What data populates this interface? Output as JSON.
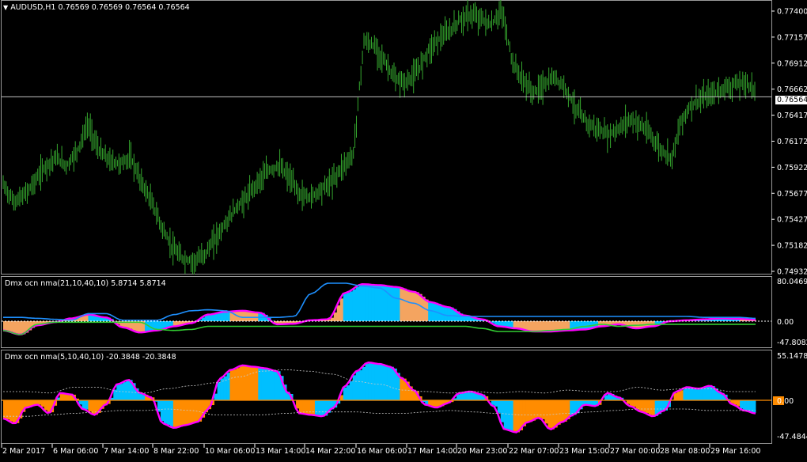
{
  "main_chart": {
    "symbol": "AUDUSD,H1",
    "ohlc": "0.76569 0.76569 0.76564 0.76564",
    "price_axis": [
      "0.77400",
      "0.77157",
      "0.76912",
      "0.76662",
      "0.76417",
      "0.76172",
      "0.75922",
      "0.75677",
      "0.75427",
      "0.75182",
      "0.74932"
    ],
    "current_price": "0.76564",
    "colors": {
      "bars": "#35a82e",
      "grid_line": "#c0c0c0",
      "background": "#000000"
    }
  },
  "indicator1": {
    "title": "Dmx ocn nma(21,10,40,10) 5.8714 5.8714",
    "axis_top": "80.0469",
    "axis_zero": "0.00",
    "axis_bottom": "-47.8082",
    "colors": {
      "positive": "#00bfff",
      "negative": "#f4a460",
      "outline": "#ff00ff",
      "upper_band": "#1e90ff",
      "lower_band": "#32cd32"
    }
  },
  "indicator2": {
    "title": "Dmx ocn nma(5,10,40,10) -20.3848 -20.3848",
    "axis_top": "55.1478",
    "axis_zero": "0.00",
    "axis_bottom": "-47.4844",
    "colors": {
      "positive": "#00bfff",
      "negative": "#ff8c00",
      "outline": "#ff00ff",
      "zero_line": "#ff8c00"
    }
  },
  "time_axis": [
    "2 Mar 2017",
    "6 Mar 06:00",
    "7 Mar 14:00",
    "8 Mar 22:00",
    "10 Mar 06:00",
    "13 Mar 14:00",
    "14 Mar 22:00",
    "16 Mar 06:00",
    "17 Mar 14:00",
    "20 Mar 23:00",
    "22 Mar 07:00",
    "23 Mar 15:00",
    "27 Mar 00:00",
    "28 Mar 08:00",
    "29 Mar 16:00"
  ],
  "chart_data": {
    "type": "line",
    "series": [
      {
        "name": "AUDUSD,H1",
        "values": [
          0.7572,
          0.7555,
          0.7562,
          0.7575,
          0.759,
          0.7598,
          0.759,
          0.7605,
          0.763,
          0.7605,
          0.7595,
          0.7592,
          0.7598,
          0.7575,
          0.7555,
          0.753,
          0.751,
          0.75,
          0.7498,
          0.7505,
          0.752,
          0.7535,
          0.755,
          0.756,
          0.7575,
          0.7585,
          0.759,
          0.7578,
          0.7562,
          0.756,
          0.7568,
          0.7575,
          0.759,
          0.76,
          0.771,
          0.7705,
          0.769,
          0.7672,
          0.767,
          0.768,
          0.77,
          0.7712,
          0.7718,
          0.773,
          0.7735,
          0.7732,
          0.7725,
          0.774,
          0.769,
          0.7672,
          0.766,
          0.7668,
          0.7675,
          0.7665,
          0.7645,
          0.7632,
          0.7625,
          0.762,
          0.7625,
          0.7635,
          0.763,
          0.762,
          0.7605,
          0.7598,
          0.7635,
          0.765,
          0.7655,
          0.766,
          0.7665,
          0.7668,
          0.767,
          0.7662
        ]
      }
    ],
    "ylim": [
      0.749,
      0.7745
    ]
  }
}
